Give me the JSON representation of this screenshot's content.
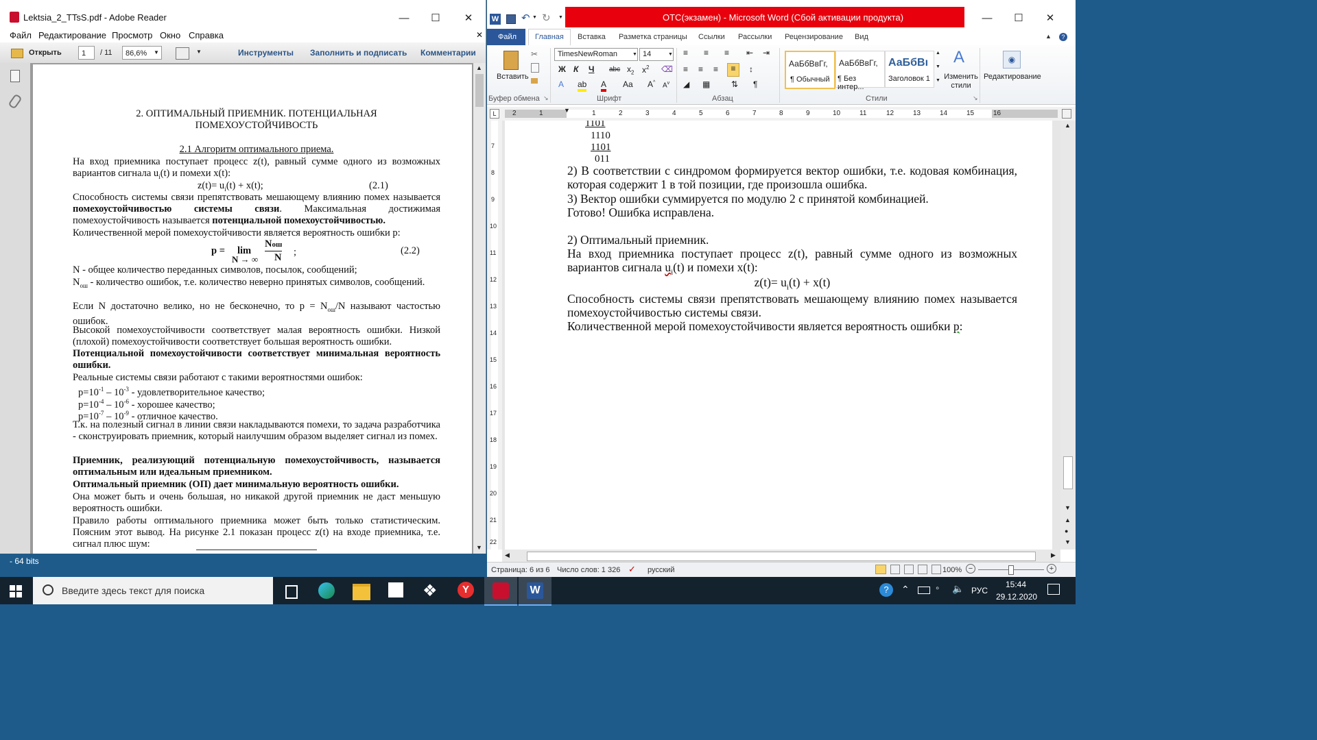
{
  "reader": {
    "title": "Lektsia_2_TTsS.pdf - Adobe Reader",
    "menu": [
      "Файл",
      "Редактирование",
      "Просмотр",
      "Окно",
      "Справка"
    ],
    "toolbar": {
      "open_label": "Открыть",
      "page_current": "1",
      "page_total": "/ 11",
      "zoom": "86,6%",
      "tools": "Инструменты",
      "fill_sign": "Заполнить и подписать",
      "comments": "Комментарии"
    },
    "page": {
      "heading1": "2. ОПТИМАЛЬНЫЙ ПРИЕМНИК.  ПОТЕНЦИАЛЬНАЯ",
      "heading2": "ПОМЕХОУСТОЙЧИВОСТЬ",
      "section": "2.1 Алгоритм оптимального приема.",
      "p1": " На вход приемника поступает процесс z(t), равный сумме одного из возможных вариантов сигнала u",
      "p1_sub": "i",
      "p1_tail": "(t) и помехи x(t):",
      "eq1": "z(t)= u",
      "eq1_sub": "i",
      "eq1_tail": "(t) + x(t);",
      "eq1_num": "(2.1)",
      "p2a": " Способность системы связи препятствовать мешающему влиянию помех называется ",
      "p2b": "помехоустойчивостью системы связи",
      "p2c": ".  Максимальная достижимая помехоустойчивость называется ",
      "p2d": "потенциальной помехоустойчивостью.",
      "p3": "Количественной мерой помехоустойчивости является вероятность ошибки p:",
      "eq2_p": "p  =",
      "eq2_lim": "lim",
      "eq2_cond": "N → ∞",
      "eq2_num": "N",
      "eq2_numsub": "ош",
      "eq2_den": "N",
      "eq2_semicolon": ";",
      "eq2_tag": "(2.2)",
      "p4": "N - общее количество переданных символов, посылок, сообщений;",
      "p5a": "N",
      "p5sub": "ош",
      "p5b": " - количество ошибок, т.е. количество неверно принятых символов, сообщений.",
      "p6a": "Если N достаточно велико, но не бесконечно, то p = N",
      "p6sub": "ош",
      "p6b": "/N называют частостью ошибок.",
      "p7": "Высокой помехоустойчивости соответствует малая вероятность ошибки. Низкой (плохой) помехоустойчивости соответствует большая вероятность ошибки.",
      "p8": "Потенциальной помехоустойчивости соответствует минимальная вероятность ошибки.",
      "p9": "Реальные системы связи работают с такими вероятностями ошибок:",
      "r1a": "p=10",
      "r1e1": "-1",
      "r1b": " – 10",
      "r1e2": "-3",
      "r1c": " - удовлетворительное качество;",
      "r2a": "p=10",
      "r2e1": "-4",
      "r2b": " – 10",
      "r2e2": "-6",
      "r2c": " - хорошее качество;",
      "r3a": "p=10",
      "r3e1": "-7",
      "r3b": " – 10",
      "r3e2": "-9",
      "r3c": " - отличное качество.",
      "p10": "Т.к. на полезный сигнал в линии связи накладываются помехи, то задача разработчика - сконструировать приемник, который наилучшим образом выделяет сигнал из помех.",
      "p11": "Приемник, реализующий потенциальную помехоустойчивость, называется оптимальным или идеальным приемником.",
      "p12": "Оптимальный приемник (ОП) дает минимальную вероятность ошибки.",
      "p13": "Она может быть и очень большая, но никакой другой приемник не даст меньшую вероятность ошибки.",
      "p14": "Правило работы оптимального приемника может быть только статистическим. Поясним этот вывод. На рисунке 2.1 показан процесс z(t) на входе приемника, т.е. сигнал плюс шум:"
    }
  },
  "bg_window_text": "- 64 bits",
  "word": {
    "title": "ОТС(экзамен) - Microsoft Word (Сбой активации продукта)",
    "tabs": [
      "Файл",
      "Главная",
      "Вставка",
      "Разметка страницы",
      "Ссылки",
      "Рассылки",
      "Рецензирование",
      "Вид"
    ],
    "font_name": "TimesNewRoman",
    "font_size": "14",
    "paste_label": "Вставить",
    "groups": [
      "Буфер обмена",
      "Шрифт",
      "Абзац",
      "Стили"
    ],
    "styles": [
      {
        "sample": "АаБбВвГг,",
        "name": "¶ Обычный"
      },
      {
        "sample": "АаБбВвГг,",
        "name": "¶ Без интер..."
      },
      {
        "sample": "АаБбВı",
        "name": "Заголовок 1"
      }
    ],
    "change_styles": "Изменить стили",
    "editing": "Редактирование",
    "ruler": [
      "2",
      "1",
      "1",
      "2",
      "3",
      "4",
      "5",
      "6",
      "7",
      "8",
      "9",
      "10",
      "11",
      "12",
      "13",
      "14",
      "15",
      "16"
    ],
    "vruler": [
      "7",
      "8",
      "9",
      "10",
      "11",
      "12",
      "13",
      "14",
      "15",
      "16",
      "17",
      "18",
      "19",
      "20",
      "21",
      "22"
    ],
    "doc": {
      "b1": "1101",
      "b2": "1110",
      "b3": "1101",
      "b4": "011",
      "l1": "2) В соответствии с синдромом формируется вектор ошибки, т.е. кодовая комбинация, которая содержит 1 в той позиции, где произошла ошибка.",
      "l2": "3) Вектор ошибки суммируется по модулю 2 с принятой комбинацией.",
      "l3": "Готово! Ошибка исправлена.",
      "l4": "2) Оптимальный приемник.",
      "l5a": "На вход приемника поступает процесс z(t), равный сумме одного из возможных вариантов сигнала ",
      "l5u": "u",
      "l5sub": "i",
      "l5b": "(t) и помехи x(t):",
      "eqa": "z(t)= u",
      "eqsub": "i",
      "eqb": "(t) + x(t)",
      "l6": "Способность системы связи препятствовать мешающему влиянию помех называется помехоустойчивостью системы связи.",
      "l7a": "Количественной мерой помехоустойчивости является вероятность ошибки ",
      "l7p": "p",
      "l7b": ":"
    },
    "status": {
      "page": "Страница: 6 из 6",
      "words": "Число слов: 1 326",
      "lang": "русский",
      "zoom": "100%"
    }
  },
  "taskbar": {
    "search_placeholder": "Введите здесь текст для поиска",
    "lang": "РУС",
    "time": "15:44",
    "date": "29.12.2020"
  },
  "colors": {
    "word_blue": "#2b579a",
    "word_red_bar": "#e8000c",
    "reader_link": "#2a5587",
    "taskbar": "#14222e"
  }
}
